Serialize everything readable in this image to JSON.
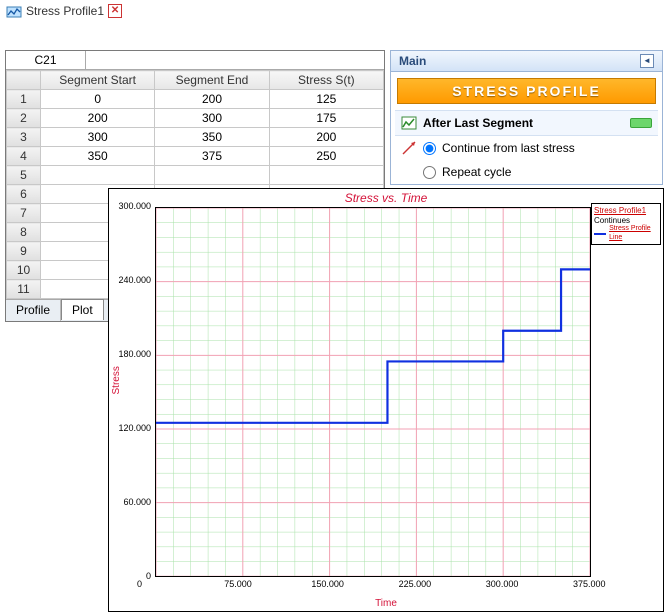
{
  "window": {
    "title": "Stress Profile1"
  },
  "cellref": "C21",
  "columns": {
    "start": "Segment Start",
    "end": "Segment End",
    "stress": "Stress S(t)"
  },
  "rows": [
    {
      "n": "1",
      "start": "0",
      "end": "200",
      "stress": "125"
    },
    {
      "n": "2",
      "start": "200",
      "end": "300",
      "stress": "175"
    },
    {
      "n": "3",
      "start": "300",
      "end": "350",
      "stress": "200"
    },
    {
      "n": "4",
      "start": "350",
      "end": "375",
      "stress": "250"
    },
    {
      "n": "5"
    },
    {
      "n": "6"
    },
    {
      "n": "7"
    },
    {
      "n": "8"
    },
    {
      "n": "9"
    },
    {
      "n": "10"
    },
    {
      "n": "11"
    }
  ],
  "tabs": {
    "profile": "Profile",
    "plot": "Plot"
  },
  "panel": {
    "header": "Main",
    "banner": "Stress Profile",
    "section": "After Last Segment",
    "opt_continue": "Continue from last stress",
    "opt_repeat": "Repeat cycle"
  },
  "chart_data": {
    "type": "line",
    "title": "Stress vs. Time",
    "xlabel": "Time",
    "ylabel": "Stress",
    "xlim": [
      0,
      375
    ],
    "ylim": [
      0,
      300
    ],
    "xticks": [
      0,
      75,
      150,
      225,
      300,
      375
    ],
    "yticks": [
      0,
      60,
      120,
      180,
      240,
      300
    ],
    "xticklabels": [
      "0",
      "75.000",
      "150.000",
      "225.000",
      "300.000",
      "375.000"
    ],
    "yticklabels": [
      "0",
      "60.000",
      "120.000",
      "180.000",
      "240.000",
      "300.000"
    ],
    "legend_title": "Stress Profile1",
    "legend_subtitle": "Continues",
    "series": [
      {
        "name": "Stress Profile Line",
        "color": "#1030e0",
        "points": [
          [
            0,
            125
          ],
          [
            200,
            125
          ],
          [
            200,
            175
          ],
          [
            300,
            175
          ],
          [
            300,
            200
          ],
          [
            350,
            200
          ],
          [
            350,
            250
          ],
          [
            375,
            250
          ]
        ]
      }
    ]
  }
}
